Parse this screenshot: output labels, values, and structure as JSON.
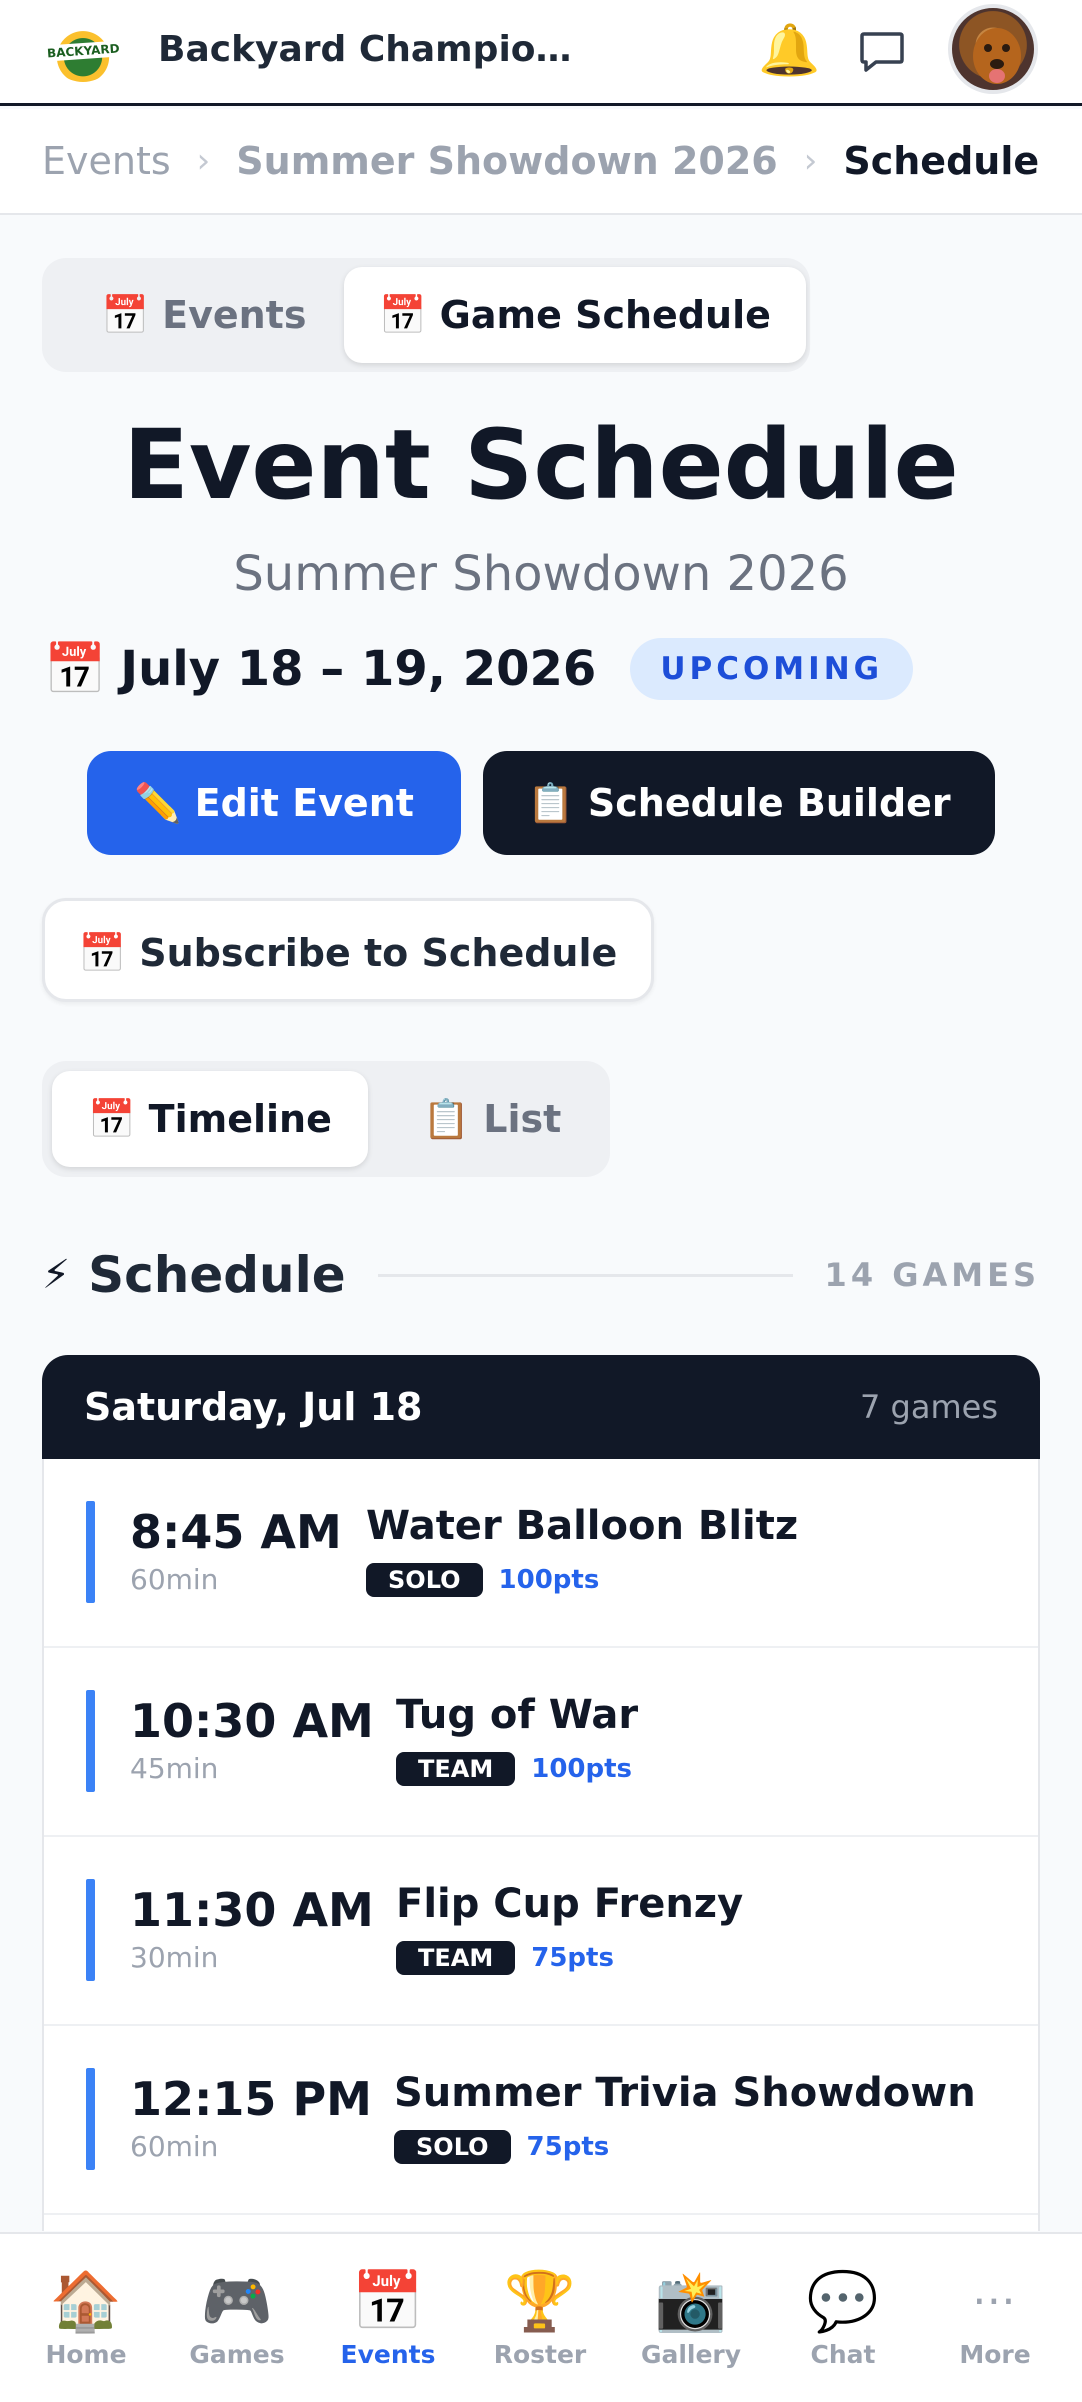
{
  "header": {
    "app_title": "Backyard Champio…",
    "logo_text": "BACKYARD"
  },
  "breadcrumb": [
    "Events",
    "Summer Showdown 2026",
    "Schedule"
  ],
  "top_tabs": [
    {
      "icon": "📅",
      "label": "Events"
    },
    {
      "icon": "📅",
      "label": "Game Schedule"
    }
  ],
  "page": {
    "title": "Event Schedule",
    "subtitle": "Summer Showdown 2026",
    "date_icon": "📅",
    "date_range": "July 18 – 19, 2026",
    "status": "UPCOMING"
  },
  "actions": {
    "edit": "✏️ Edit Event",
    "builder": "📋 Schedule Builder",
    "subscribe": "📅 Subscribe to Schedule"
  },
  "view_toggle": [
    {
      "icon": "📅",
      "label": "Timeline"
    },
    {
      "icon": "📋",
      "label": "List"
    }
  ],
  "schedule": {
    "icon": "⚡",
    "title": "Schedule",
    "count": "14 GAMES",
    "day": {
      "title": "Saturday, Jul 18",
      "count": "7 games",
      "games": [
        {
          "time": "8:45 AM",
          "duration": "60min",
          "name": "Water Balloon Blitz",
          "type": "SOLO",
          "points": "100pts"
        },
        {
          "time": "10:30 AM",
          "duration": "45min",
          "name": "Tug of War",
          "type": "TEAM",
          "points": "100pts"
        },
        {
          "time": "11:30 AM",
          "duration": "30min",
          "name": "Flip Cup Frenzy",
          "type": "TEAM",
          "points": "75pts"
        },
        {
          "time": "12:15 PM",
          "duration": "60min",
          "name": "Summer Trivia Showdown",
          "type": "SOLO",
          "points": "75pts"
        }
      ]
    }
  },
  "bottom_nav": [
    {
      "icon": "🏠",
      "label": "Home"
    },
    {
      "icon": "🎮",
      "label": "Games"
    },
    {
      "icon": "📅",
      "label": "Events"
    },
    {
      "icon": "🏆",
      "label": "Roster"
    },
    {
      "icon": "📸",
      "label": "Gallery"
    },
    {
      "icon": "💬",
      "label": "Chat"
    },
    {
      "icon": "⋯",
      "label": "More"
    }
  ],
  "colors": {
    "accent": "#2563eb",
    "dark": "#111827",
    "status_bg": "#dbeafe",
    "timeline_bar": "#3b82f6"
  }
}
